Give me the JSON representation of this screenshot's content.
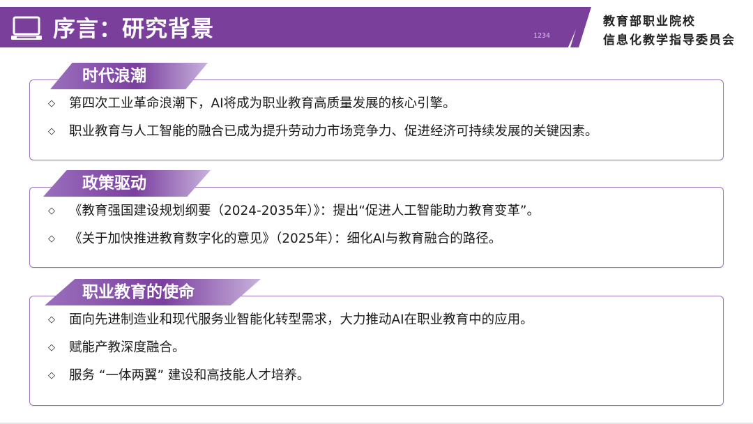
{
  "header": {
    "title": "序言：研究背景",
    "org_line1": "教育部职业院校",
    "org_line2": "信息化教学指导委员会",
    "deco_text": "1234"
  },
  "colors": {
    "accent": "#7a3f9a",
    "border": "#9b73b8"
  },
  "sections": [
    {
      "title": "时代浪潮",
      "items": [
        "第四次工业革命浪潮下，AI将成为职业教育高质量发展的核心引擎。",
        "职业教育与人工智能的融合已成为提升劳动力市场竞争力、促进经济可持续发展的关键因素。"
      ]
    },
    {
      "title": "政策驱动",
      "items": [
        "《教育强国建设规划纲要（2024-2035年）》：提出“促进人工智能助力教育变革”。",
        "《关于加快推进教育数字化的意见》（2025年）：细化AI与教育融合的路径。"
      ]
    },
    {
      "title": "职业教育的使命",
      "items": [
        "面向先进制造业和现代服务业智能化转型需求，大力推动AI在职业教育中的应用。",
        "赋能产教深度融合。",
        "服务 “一体两翼” 建设和高技能人才培养。"
      ]
    }
  ],
  "bullet_symbol": "◇",
  "icons": {
    "header": "computer-icon"
  }
}
